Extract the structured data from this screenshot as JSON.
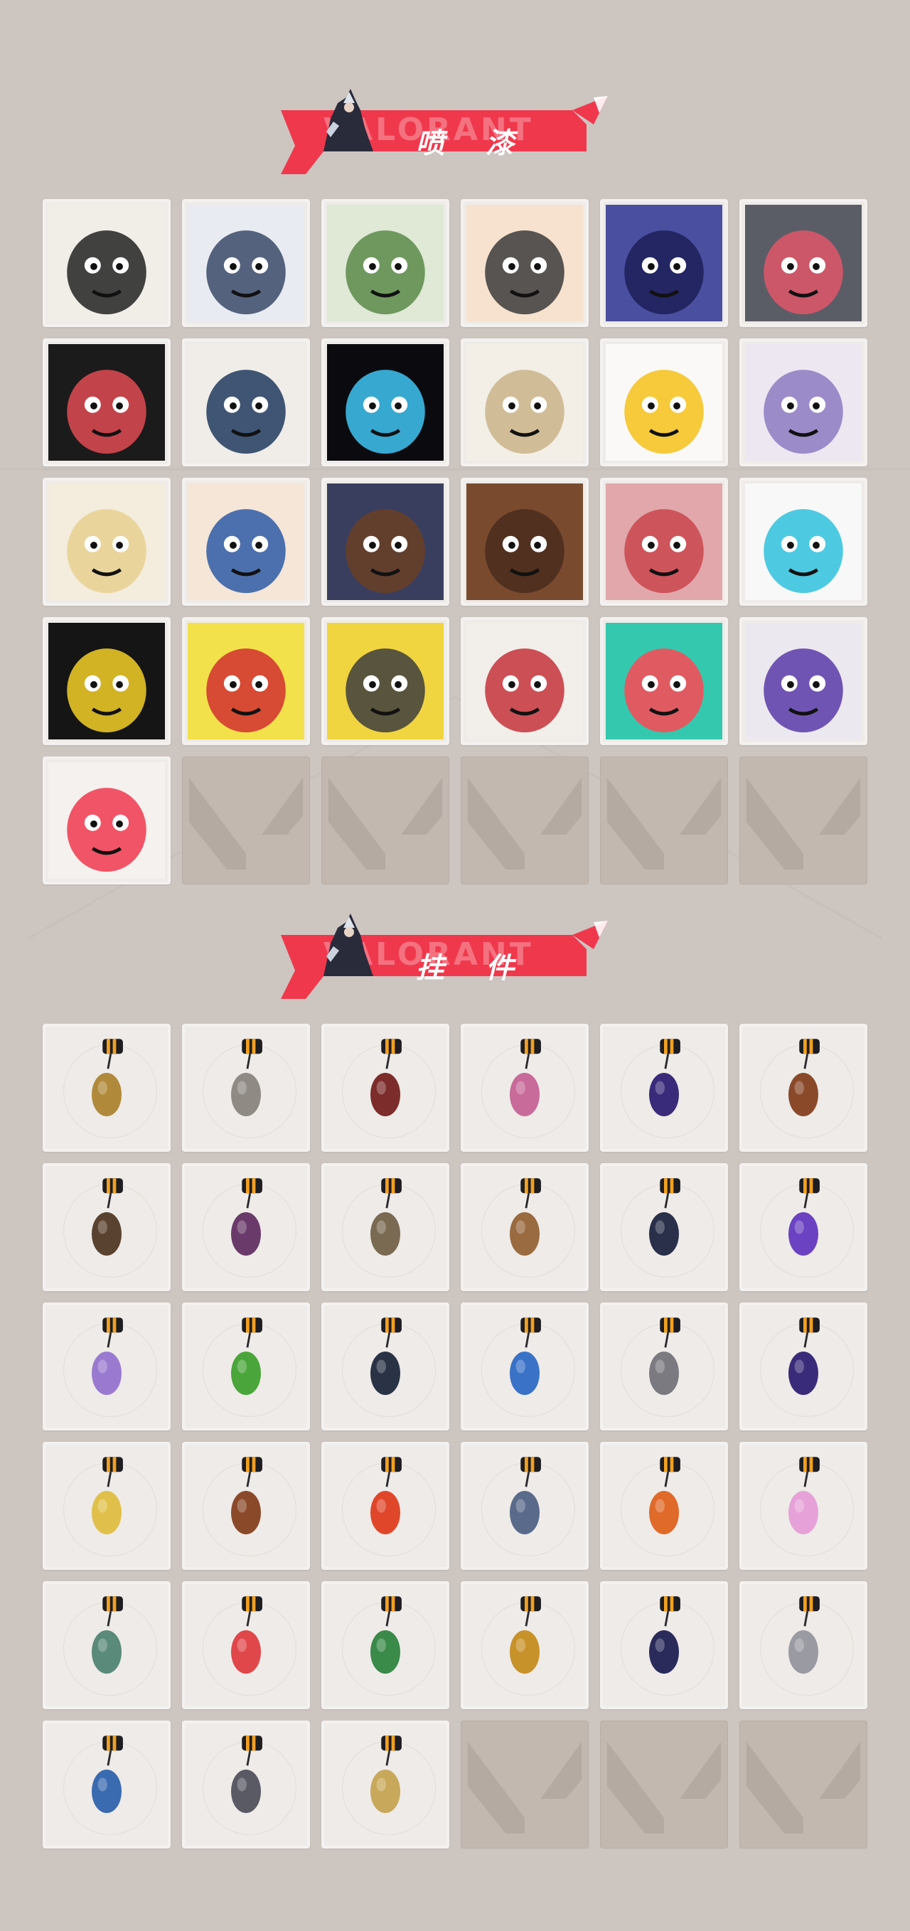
{
  "sprays_section": {
    "title": "喷 漆",
    "watermark": "VALORANT"
  },
  "charms_section": {
    "title": "挂 件",
    "watermark": "VALORANT"
  },
  "sprays": [
    {
      "icon": "girl-pencil-spray-icon",
      "bg": "#f1eee8",
      "accent": "#222222"
    },
    {
      "icon": "penguin-beanie-spray-icon",
      "bg": "#e8ecf2",
      "accent": "#3b4a6a"
    },
    {
      "icon": "frog-hat-spray-icon",
      "bg": "#dfe9d6",
      "accent": "#5c8a4a"
    },
    {
      "icon": "neutral-face-spray-icon",
      "bg": "#f7e2cf",
      "accent": "#3b3b3b"
    },
    {
      "icon": "blue-hair-agent-spray-icon",
      "bg": "#4a4fa0",
      "accent": "#1c1f57"
    },
    {
      "icon": "grey-cat-laughing-spray-icon",
      "bg": "#5b5d66",
      "accent": "#e05668"
    },
    {
      "icon": "red-blob-spray-icon",
      "bg": "#1b1b1b",
      "accent": "#e04a52"
    },
    {
      "icon": "hooded-agent-spray-icon",
      "bg": "#f0ede8",
      "accent": "#203a5e"
    },
    {
      "icon": "blue-flame-spray-icon",
      "bg": "#0b0b0f",
      "accent": "#3fc4f2"
    },
    {
      "icon": "gold-v-logo-spray-icon",
      "bg": "#f3efe6",
      "accent": "#c9b48a"
    },
    {
      "icon": "gold-star-spray-icon",
      "bg": "#faf9f7",
      "accent": "#f4c21a"
    },
    {
      "icon": "purple-hair-wink-spray-icon",
      "bg": "#ede7f2",
      "accent": "#8d7ac2"
    },
    {
      "icon": "blonde-agent-spray-icon",
      "bg": "#f4ecdc",
      "accent": "#e6d190"
    },
    {
      "icon": "blue-cap-agent-spray-icon",
      "bg": "#f5e6d8",
      "accent": "#2e5aa7"
    },
    {
      "icon": "sunglasses-agent-spray-icon",
      "bg": "#3a3e5e",
      "accent": "#6a3f25"
    },
    {
      "icon": "bearded-agent-spray-icon",
      "bg": "#7a4a2f",
      "accent": "#4a2c1c"
    },
    {
      "icon": "ammo-zero-spray-icon",
      "bg": "#e1a7aa",
      "accent": "#c9454e"
    },
    {
      "icon": "blue-orb-spray-icon",
      "bg": "#f8f8f8",
      "accent": "#2fc2dd"
    },
    {
      "icon": "yellow-creature-spray-icon",
      "bg": "#151515",
      "accent": "#f2cf27"
    },
    {
      "icon": "bandana-bunny-spray-icon",
      "bg": "#f2e14a",
      "accent": "#d22f2f"
    },
    {
      "icon": "gauntlet-fist-spray-icon",
      "bg": "#f1d540",
      "accent": "#3d3d3d"
    },
    {
      "icon": "red-x-button-spray-icon",
      "bg": "#f2eeea",
      "accent": "#c5333b"
    },
    {
      "icon": "valorant-logo-splash-spray-icon",
      "bg": "#34c9ae",
      "accent": "#ff4655"
    },
    {
      "icon": "purple-graffiti-spray-icon",
      "bg": "#ece8ef",
      "accent": "#5a3aa8"
    },
    {
      "icon": "red-valorant-drip-spray-icon",
      "bg": "#f4f1ee",
      "accent": "#f0384d"
    }
  ],
  "spray_slots_total": 30,
  "charms": [
    {
      "icon": "gold-bear-charm-icon",
      "color": "#b08a3a"
    },
    {
      "icon": "sushi-tray-charm-icon",
      "color": "#8f8a84"
    },
    {
      "icon": "braided-rope-charm-icon",
      "color": "#7c2c2a"
    },
    {
      "icon": "cupcake-charm-icon",
      "color": "#c86a9a"
    },
    {
      "icon": "ep9-medallion-charm-icon",
      "color": "#3a2b7a"
    },
    {
      "icon": "teddy-bear-boxing-charm-icon",
      "color": "#8a4a2a"
    },
    {
      "icon": "bomb-device-charm-icon",
      "color": "#5a4230"
    },
    {
      "icon": "agent-figure-charm-icon",
      "color": "#6a3a6a"
    },
    {
      "icon": "hat-agent-figure-charm-icon",
      "color": "#7a6a52"
    },
    {
      "icon": "cardboard-box-charm-icon",
      "color": "#9a6a40"
    },
    {
      "icon": "robot-tassel-charm-icon",
      "color": "#2a2f4a"
    },
    {
      "icon": "purple-crystal-charm-icon",
      "color": "#6a42c2"
    },
    {
      "icon": "lava-lamp-charm-icon",
      "color": "#9a7ad0"
    },
    {
      "icon": "green-pager-charm-icon",
      "color": "#4aa63a"
    },
    {
      "icon": "sneaker-charm-icon",
      "color": "#2a3346"
    },
    {
      "icon": "astronaut-charm-icon",
      "color": "#3a72c8"
    },
    {
      "icon": "radio-device-charm-icon",
      "color": "#7a7a80"
    },
    {
      "icon": "ep9-medallion-purple-charm-icon",
      "color": "#3a2b7a"
    },
    {
      "icon": "banana-slice-charm-icon",
      "color": "#e0c04a"
    },
    {
      "icon": "ice-cream-bar-charm-icon",
      "color": "#8a4a2a"
    },
    {
      "icon": "skewer-charm-icon",
      "color": "#e0472a"
    },
    {
      "icon": "chibi-agent-card-charm-icon",
      "color": "#5a6a8a"
    },
    {
      "icon": "hot-air-balloon-charm-icon",
      "color": "#e06a2a"
    },
    {
      "icon": "pink-flower-charm-icon",
      "color": "#e6a2d8"
    },
    {
      "icon": "robot-bot-charm-icon",
      "color": "#5a8a7a"
    },
    {
      "icon": "watermelon-slice-charm-icon",
      "color": "#e0474a"
    },
    {
      "icon": "soda-can-charm-icon",
      "color": "#3a8a4a"
    },
    {
      "icon": "honey-pot-bee-charm-icon",
      "color": "#c8922a"
    },
    {
      "icon": "ep9-medallion-dark-charm-icon",
      "color": "#2a2b5a"
    },
    {
      "icon": "silver-swirl-charm-icon",
      "color": "#9a9aa2"
    },
    {
      "icon": "ufo-charm-icon",
      "color": "#3a6ab0"
    },
    {
      "icon": "grey-cat-plush-charm-icon",
      "color": "#5a5a64"
    },
    {
      "icon": "gold-v-medallion-charm-icon",
      "color": "#c8a85a"
    }
  ],
  "charm_slots_total": 36
}
